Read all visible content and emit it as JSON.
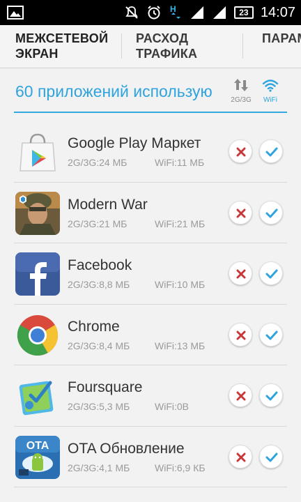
{
  "status_bar": {
    "time": "14:07",
    "battery": "23",
    "network_letter": "H",
    "icons": [
      "image-notification-icon",
      "mute-icon",
      "alarm-icon",
      "network-h-icon",
      "signal-icon",
      "signal-icon",
      "battery-icon"
    ]
  },
  "tabs": [
    {
      "line1": "МЕЖСЕТЕВОЙ",
      "line2": "ЭКРАН",
      "active": true
    },
    {
      "line1": "РАСХОД",
      "line2": "ТРАФИКА",
      "active": false
    },
    {
      "line1": "ПАРАМ",
      "line2": "",
      "active": false
    }
  ],
  "header": {
    "count_text": "60 приложений использую",
    "mobile_label": "2G/3G",
    "wifi_label": "WiFi"
  },
  "apps": [
    {
      "name": "Google Play Маркет",
      "mobile": "2G/3G:24 МБ",
      "wifi": "WiFi:11 МБ",
      "icon": "google-play-icon"
    },
    {
      "name": "Modern War",
      "mobile": "2G/3G:21 МБ",
      "wifi": "WiFi:21 МБ",
      "icon": "modern-war-icon"
    },
    {
      "name": "Facebook",
      "mobile": "2G/3G:8,8 МБ",
      "wifi": "WiFi:10 МБ",
      "icon": "facebook-icon"
    },
    {
      "name": "Chrome",
      "mobile": "2G/3G:8,4 МБ",
      "wifi": "WiFi:13 МБ",
      "icon": "chrome-icon"
    },
    {
      "name": "Foursquare",
      "mobile": "2G/3G:5,3 МБ",
      "wifi": "WiFi:0В",
      "icon": "foursquare-icon"
    },
    {
      "name": "OTA Обновление",
      "mobile": "2G/3G:4,1 МБ",
      "wifi": "WiFi:6,9 КБ",
      "icon": "ota-update-icon",
      "icon_text": "OTA"
    }
  ],
  "colors": {
    "accent": "#33a9e0",
    "deny": "#c8373a",
    "allow": "#2ea3dd",
    "statusbar_bg": "#000000"
  }
}
